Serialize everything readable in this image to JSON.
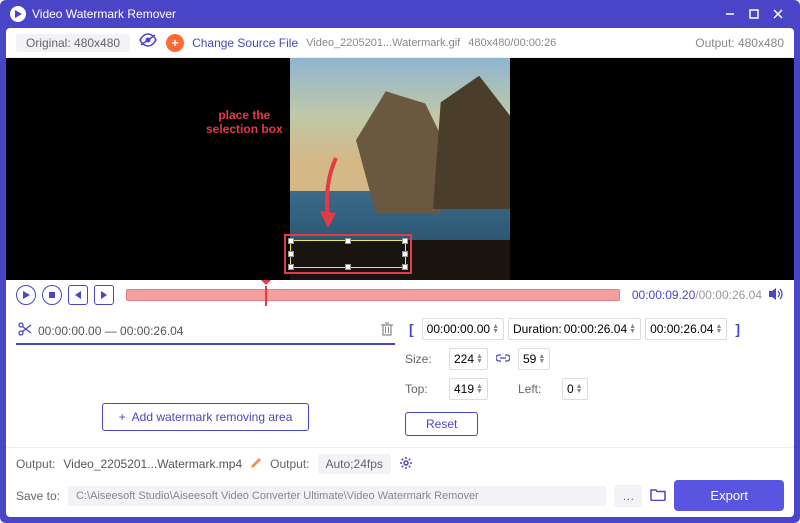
{
  "titlebar": {
    "title": "Video Watermark Remover"
  },
  "toolbar": {
    "original_label": "Original: 480x480",
    "change_source": "Change Source File",
    "file_name": "Video_2205201...Watermark.gif",
    "file_meta": "480x480/00:00:26",
    "output_label": "Output: 480x480"
  },
  "instruction": {
    "line1": "place the",
    "line2": "selection box"
  },
  "playback": {
    "current": "00:00:09.20",
    "total": "/00:00:26.04"
  },
  "range_panel": {
    "range_text": "00:00:00.00 — 00:00:26.04",
    "add_btn": "Add watermark removing area"
  },
  "props": {
    "start_time": "00:00:00.00",
    "duration_label": "Duration:",
    "duration": "00:00:26.04",
    "end_time": "00:00:26.04",
    "size_label": "Size:",
    "width": "224",
    "height": "59",
    "top_label": "Top:",
    "top": "419",
    "left_label": "Left:",
    "left": "0",
    "reset": "Reset"
  },
  "bottom": {
    "output_label": "Output:",
    "output_file": "Video_2205201...Watermark.mp4",
    "format_label": "Output:",
    "format_value": "Auto;24fps",
    "saveto_label": "Save to:",
    "saveto_path": "C:\\Aiseesoft Studio\\Aiseesoft Video Converter Ultimate\\Video Watermark Remover",
    "export": "Export"
  }
}
